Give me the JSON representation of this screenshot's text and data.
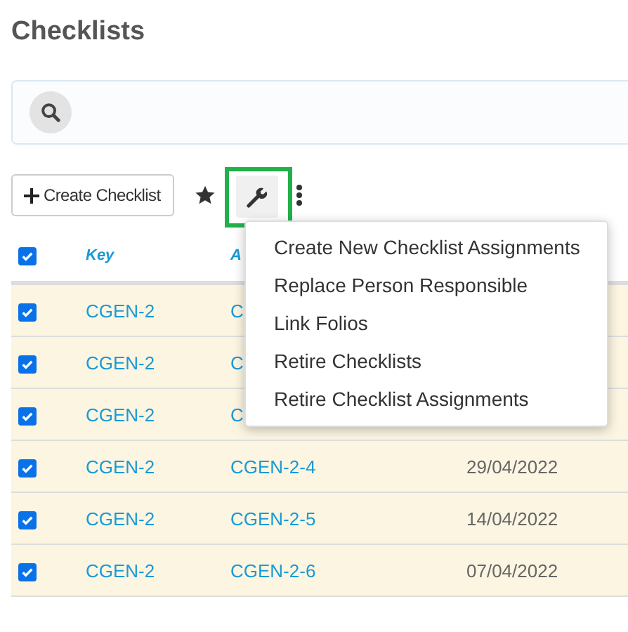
{
  "title": "Checklists",
  "toolbar": {
    "create_button": "Create Checklist",
    "tools_highlighted": true
  },
  "table": {
    "header_checked": true,
    "columns": [
      "Key",
      "A"
    ],
    "rows": [
      {
        "checked": true,
        "key": "CGEN-2",
        "assignment": "C"
      },
      {
        "checked": true,
        "key": "CGEN-2",
        "assignment": "C"
      },
      {
        "checked": true,
        "key": "CGEN-2",
        "assignment": "C"
      },
      {
        "checked": true,
        "key": "CGEN-2",
        "assignment": "CGEN-2-4",
        "date": "29/04/2022"
      },
      {
        "checked": true,
        "key": "CGEN-2",
        "assignment": "CGEN-2-5",
        "date": "14/04/2022"
      },
      {
        "checked": true,
        "key": "CGEN-2",
        "assignment": "CGEN-2-6",
        "date": "07/04/2022"
      }
    ]
  },
  "menu": {
    "items": [
      "Create New Checklist Assignments",
      "Replace Person Responsible",
      "Link Folios",
      "Retire Checklists",
      "Retire Checklist Assignments"
    ]
  }
}
